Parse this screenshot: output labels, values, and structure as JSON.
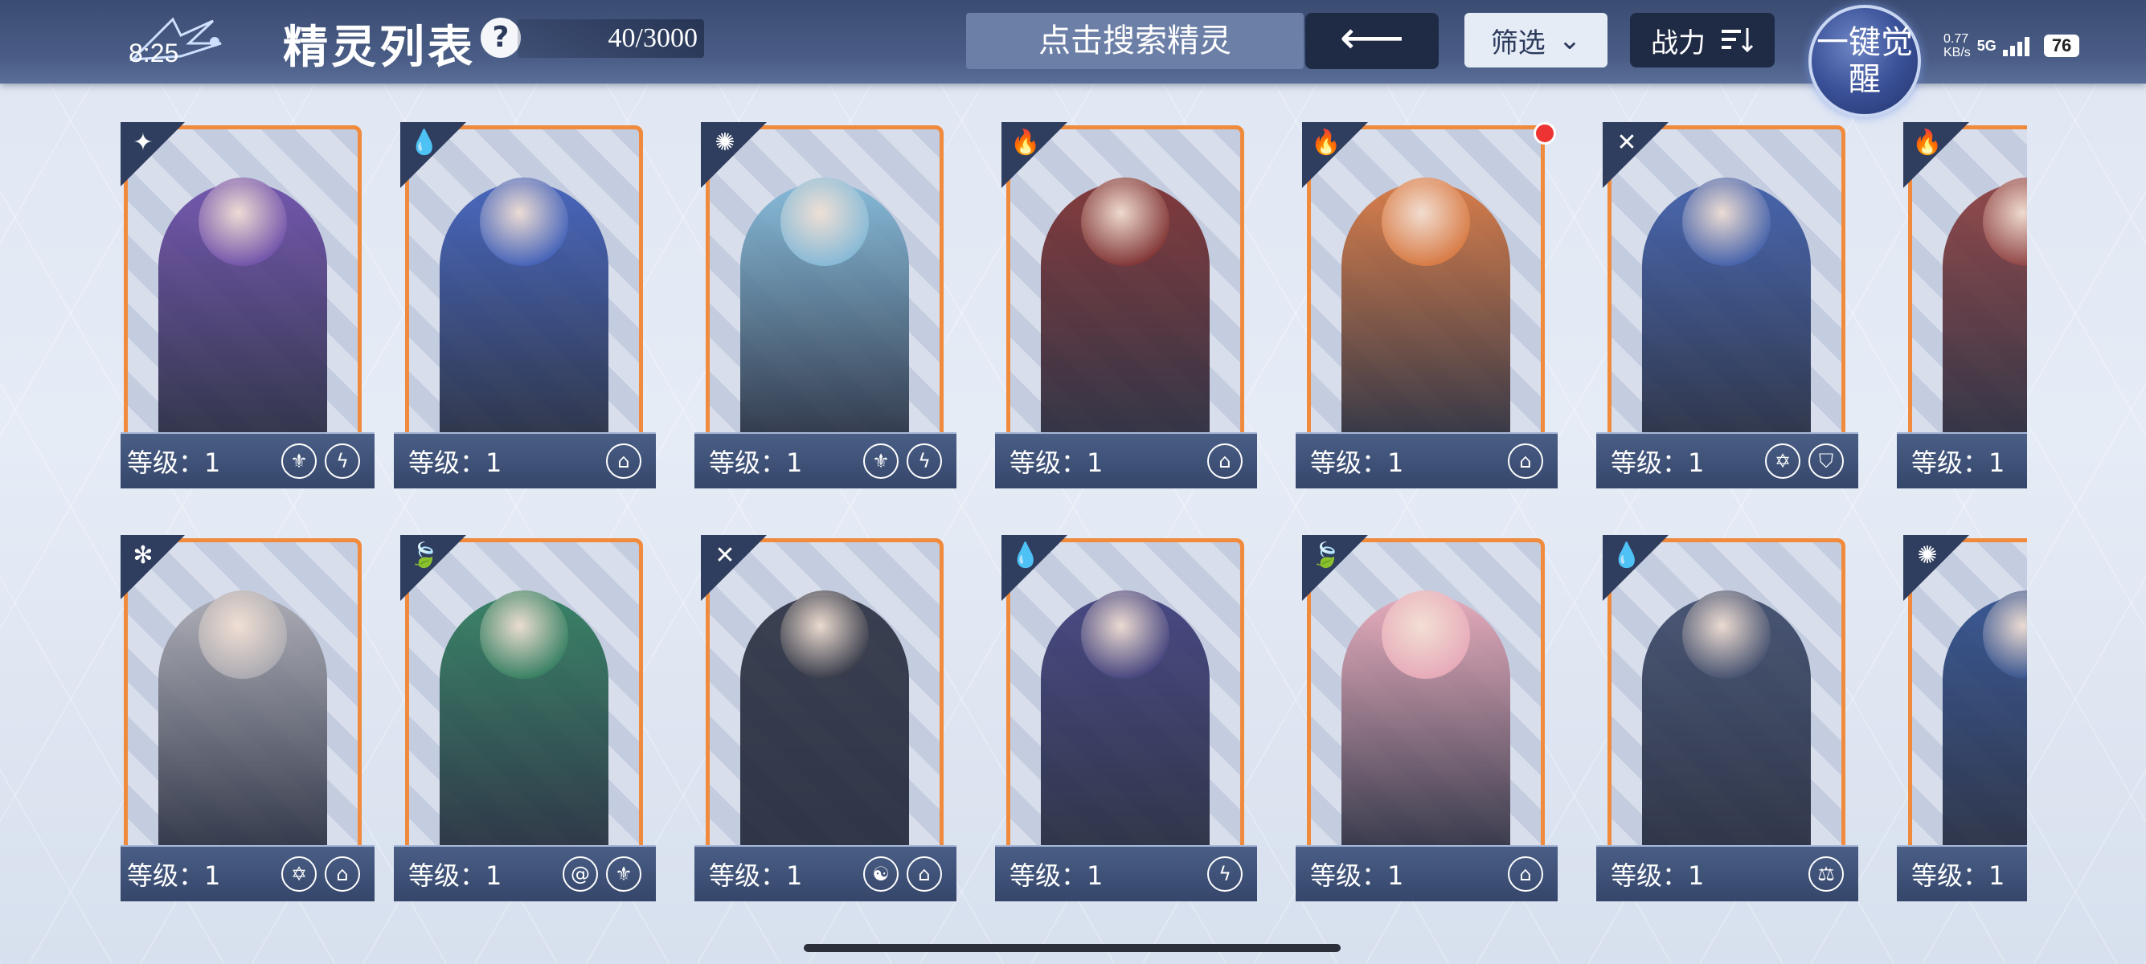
{
  "header": {
    "title": "精灵列表",
    "clock": "8:25",
    "help_label": "?",
    "count": "40/3000",
    "search_placeholder": "点击搜索精灵",
    "back_label": "⟵",
    "filter_label": "筛选",
    "power_label": "战力",
    "awaken_label": "一键觉醒"
  },
  "status": {
    "network_speed": "0.77",
    "network_unit": "KB/s",
    "network_type": "5G",
    "battery": "76"
  },
  "cards_row1": [
    {
      "level": "等级：1",
      "element": "dark",
      "skill_icons": [
        "shield-crest-icon",
        "lightning-icon"
      ],
      "color": "#6a4aa8"
    },
    {
      "level": "等级：1",
      "element": "water",
      "skill_icons": [
        "book-icon"
      ],
      "color": "#3a5bb8"
    },
    {
      "level": "等级：1",
      "element": "light",
      "skill_icons": [
        "shield-crest-icon",
        "lightning-icon"
      ],
      "color": "#7fb8d8"
    },
    {
      "level": "等级：1",
      "element": "fire",
      "skill_icons": [
        "book-icon"
      ],
      "color": "#7a2a2a"
    },
    {
      "level": "等级：1",
      "element": "fire",
      "skill_icons": [
        "book-icon"
      ],
      "color": "#d8743a"
    },
    {
      "level": "等级：1",
      "element": "neutral",
      "skill_icons": [
        "star-icon",
        "shield-icon"
      ],
      "color": "#3a5aa8"
    },
    {
      "level": "等级：1",
      "element": "fire",
      "skill_icons": [],
      "color": "#8a3a3a"
    }
  ],
  "cards_row2": [
    {
      "level": "等级：1",
      "element": "ice",
      "skill_icons": [
        "star-icon",
        "book-icon"
      ],
      "color": "#a8a8b0"
    },
    {
      "level": "等级：1",
      "element": "grass",
      "skill_icons": [
        "swirl-icon",
        "shield-crest-icon"
      ],
      "color": "#2a7a5a"
    },
    {
      "level": "等级：1",
      "element": "neutral",
      "skill_icons": [
        "taiji-icon",
        "book-icon"
      ],
      "color": "#2a3040"
    },
    {
      "level": "等级：1",
      "element": "water",
      "skill_icons": [
        "lightning-icon"
      ],
      "color": "#3a3a78"
    },
    {
      "level": "等级：1",
      "element": "grass",
      "skill_icons": [
        "book-icon"
      ],
      "color": "#e8a8b8"
    },
    {
      "level": "等级：1",
      "element": "water",
      "skill_icons": [
        "scales-icon"
      ],
      "color": "#3a4868"
    },
    {
      "level": "等级：1",
      "element": "light",
      "skill_icons": [],
      "color": "#2a4a8a"
    }
  ],
  "element_glyphs": {
    "dark": "✦",
    "water": "💧",
    "light": "✺",
    "fire": "🔥",
    "neutral": "✕",
    "ice": "✻",
    "grass": "🍃"
  },
  "skill_glyphs": {
    "shield-crest-icon": "⚜",
    "lightning-icon": "ϟ",
    "book-icon": "⌂",
    "star-icon": "✡",
    "shield-icon": "⛉",
    "swirl-icon": "@",
    "taiji-icon": "☯",
    "scales-icon": "⚖"
  },
  "colors": {
    "accent_orange": "#f08a3c",
    "bar": "#3b4c72",
    "badge_red": "#ee3333"
  }
}
